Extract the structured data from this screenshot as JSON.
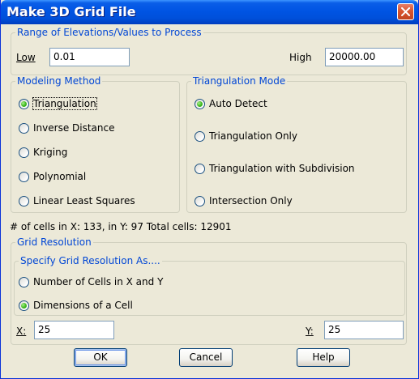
{
  "window": {
    "title": "Make 3D Grid File"
  },
  "range_group": {
    "legend": "Range of Elevations/Values to Process",
    "low_label": "Low",
    "low_value": "0.01",
    "high_label": "High",
    "high_value": "20000.00"
  },
  "modeling_group": {
    "legend": "Modeling Method",
    "options": [
      {
        "label": "Triangulation",
        "checked": true
      },
      {
        "label": "Inverse Distance",
        "checked": false
      },
      {
        "label": "Kriging",
        "checked": false
      },
      {
        "label": "Polynomial",
        "checked": false
      },
      {
        "label": "Linear Least Squares",
        "checked": false
      }
    ]
  },
  "triangulation_group": {
    "legend": "Triangulation Mode",
    "options": [
      {
        "label": "Auto Detect",
        "checked": true
      },
      {
        "label": "Triangulation Only",
        "checked": false
      },
      {
        "label": "Triangulation with Subdivision",
        "checked": false
      },
      {
        "label": "Intersection Only",
        "checked": false
      }
    ]
  },
  "cells_info": "# of cells in X: 133, in Y: 97 Total cells: 12901",
  "grid_resolution": {
    "legend": "Grid Resolution",
    "inner_legend": "Specify Grid Resolution As....",
    "options": [
      {
        "label": "Number of Cells in X and Y",
        "checked": false
      },
      {
        "label": "Dimensions of a Cell",
        "checked": true
      }
    ],
    "x_label": "X:",
    "x_value": "25",
    "y_label": "Y:",
    "y_value": "25"
  },
  "buttons": {
    "ok": "OK",
    "cancel": "Cancel",
    "help": "Help"
  },
  "colors": {
    "title_bar": "#0054e3",
    "group_legend": "#0046d5",
    "dialog_background": "#ece9d8",
    "radio_checked": "#3fb61e",
    "close_button": "#d8542f"
  },
  "icons": {
    "close": "close-icon"
  }
}
